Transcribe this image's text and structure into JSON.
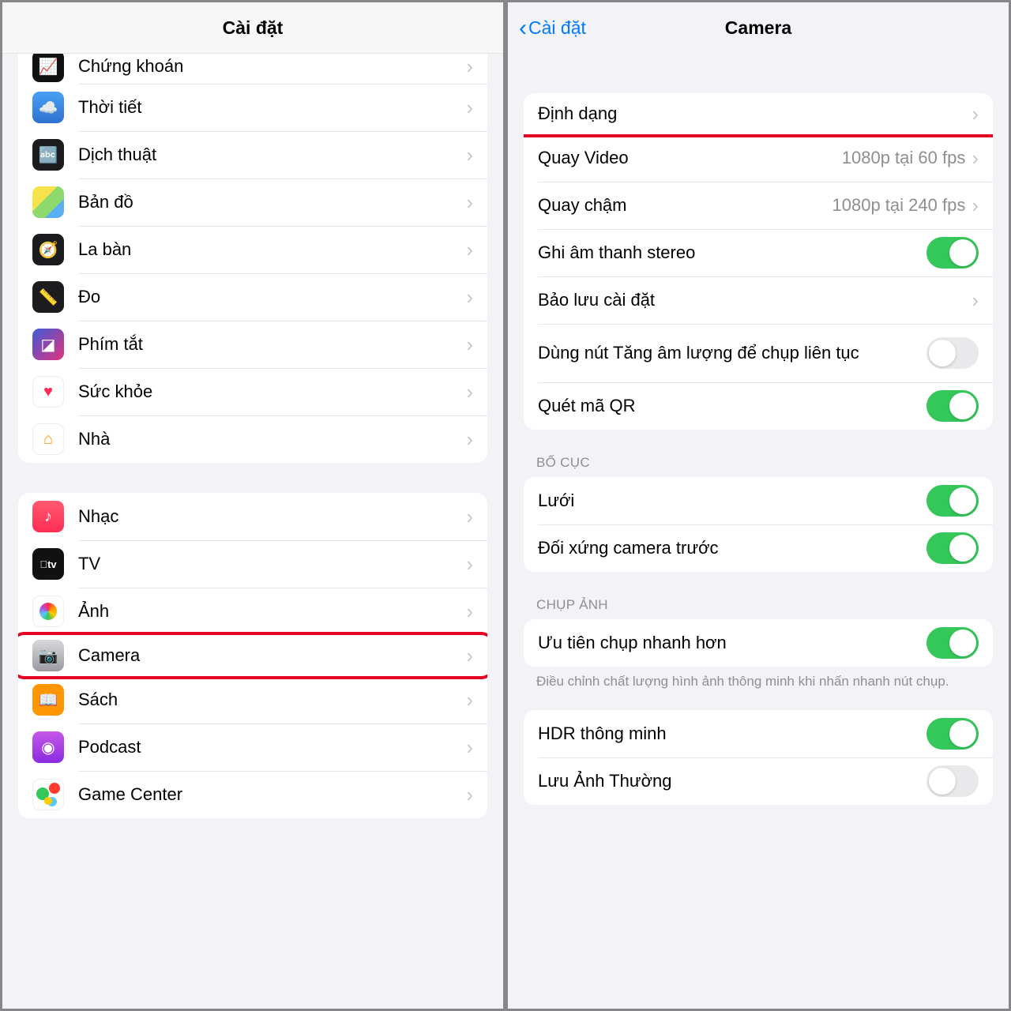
{
  "left": {
    "title": "Cài đặt",
    "group1": [
      {
        "key": "stocks",
        "label": "Chứng khoán"
      },
      {
        "key": "weather",
        "label": "Thời tiết"
      },
      {
        "key": "translate",
        "label": "Dịch thuật"
      },
      {
        "key": "maps",
        "label": "Bản đồ"
      },
      {
        "key": "compass",
        "label": "La bàn"
      },
      {
        "key": "measure",
        "label": "Đo"
      },
      {
        "key": "shortcuts",
        "label": "Phím tắt"
      },
      {
        "key": "health",
        "label": "Sức khỏe"
      },
      {
        "key": "home",
        "label": "Nhà"
      }
    ],
    "group2": [
      {
        "key": "music",
        "label": "Nhạc"
      },
      {
        "key": "tv",
        "label": "TV"
      },
      {
        "key": "photos",
        "label": "Ảnh"
      },
      {
        "key": "camera",
        "label": "Camera",
        "highlighted": true
      },
      {
        "key": "books",
        "label": "Sách"
      },
      {
        "key": "podcast",
        "label": "Podcast"
      },
      {
        "key": "gamecenter",
        "label": "Game Center"
      }
    ]
  },
  "right": {
    "back": "Cài đặt",
    "title": "Camera",
    "group1": [
      {
        "key": "format",
        "label": "Định dạng",
        "type": "disclose",
        "highlighted": true
      },
      {
        "key": "record-video",
        "label": "Quay Video",
        "type": "value",
        "value": "1080p tại 60 fps"
      },
      {
        "key": "slo-mo",
        "label": "Quay chậm",
        "type": "value",
        "value": "1080p tại 240 fps"
      },
      {
        "key": "stereo",
        "label": "Ghi âm thanh stereo",
        "type": "toggle",
        "on": true
      },
      {
        "key": "preserve",
        "label": "Bảo lưu cài đặt",
        "type": "disclose"
      },
      {
        "key": "volume-burst",
        "label": "Dùng nút Tăng âm lượng để chụp liên tục",
        "type": "toggle",
        "on": false,
        "multiline": true
      },
      {
        "key": "qr",
        "label": "Quét mã QR",
        "type": "toggle",
        "on": true
      }
    ],
    "header2": "BỐ CỤC",
    "group2": [
      {
        "key": "grid",
        "label": "Lưới",
        "type": "toggle",
        "on": true
      },
      {
        "key": "mirror",
        "label": "Đối xứng camera trước",
        "type": "toggle",
        "on": true
      }
    ],
    "header3": "CHỤP ẢNH",
    "group3": [
      {
        "key": "prioritize-fast",
        "label": "Ưu tiên chụp nhanh hơn",
        "type": "toggle",
        "on": true
      }
    ],
    "footer3": "Điều chỉnh chất lượng hình ảnh thông minh khi nhấn nhanh nút chụp.",
    "group4": [
      {
        "key": "smart-hdr",
        "label": "HDR thông minh",
        "type": "toggle",
        "on": true
      },
      {
        "key": "keep-normal",
        "label": "Lưu Ảnh Thường",
        "type": "toggle",
        "on": false
      }
    ]
  }
}
